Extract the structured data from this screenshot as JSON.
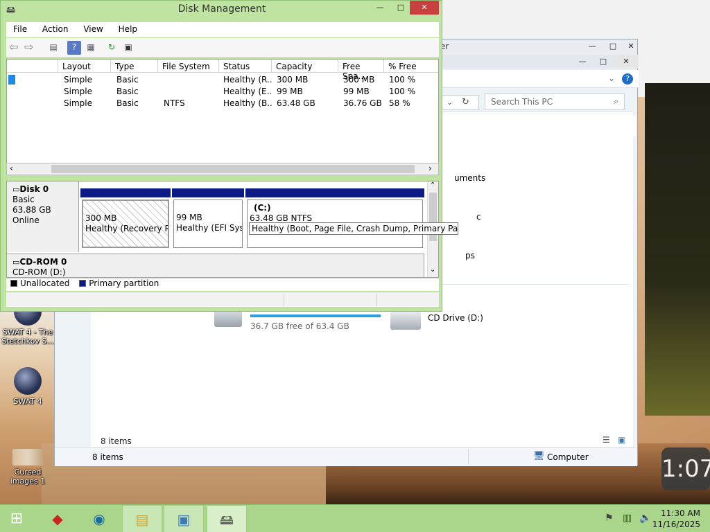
{
  "desktop": {
    "icons": [
      {
        "label": "SWAT 4 - The Stetchkov S..."
      },
      {
        "label": "SWAT 4"
      },
      {
        "label": "Cursed images 1"
      }
    ],
    "video_timestamp": "1:07"
  },
  "explorer": {
    "title_partial": "er",
    "search_placeholder": "Search This PC",
    "nav_partial": [
      {
        "text": "uments"
      },
      {
        "text": "c"
      },
      {
        "text": "ps"
      }
    ],
    "local_disk_free": "36.7 GB free of 63.4 GB",
    "cd_drive": "CD Drive (D:)",
    "items_count_top": "8 items",
    "status_items": "8 items",
    "status_location": "Computer"
  },
  "disk_mgmt": {
    "title": "Disk Management",
    "menu": [
      "File",
      "Action",
      "View",
      "Help"
    ],
    "columns": [
      "Layout",
      "Type",
      "File System",
      "Status",
      "Capacity",
      "Free Spa...",
      "% Free"
    ],
    "rows": [
      [
        "Simple",
        "Basic",
        "",
        "Healthy (R...",
        "300 MB",
        "300 MB",
        "100 %"
      ],
      [
        "Simple",
        "Basic",
        "",
        "Healthy (E...",
        "99 MB",
        "99 MB",
        "100 %"
      ],
      [
        "Simple",
        "Basic",
        "NTFS",
        "Healthy (B...",
        "63.48 GB",
        "36.76 GB",
        "58 %"
      ]
    ],
    "disk0": {
      "name": "Disk 0",
      "type": "Basic",
      "size": "63.88 GB",
      "state": "Online"
    },
    "partitions": [
      {
        "size": "300 MB",
        "status": "Healthy (Recovery Par"
      },
      {
        "size": "99 MB",
        "status": "Healthy (EFI Syste"
      },
      {
        "label": "(C:)",
        "size": "63.48 GB NTFS",
        "status": "Healthy (Boot, Page File, Crash Dump, Primary Partition)"
      }
    ],
    "cdrom": {
      "name": "CD-ROM 0",
      "sub": "CD-ROM (D:)"
    },
    "legend": {
      "unallocated": "Unallocated",
      "primary": "Primary partition"
    },
    "colors": {
      "unallocated": "#000000",
      "primary": "#0c1a84"
    }
  },
  "taskbar": {
    "time": "11:30 AM",
    "date": "11/16/2025"
  }
}
